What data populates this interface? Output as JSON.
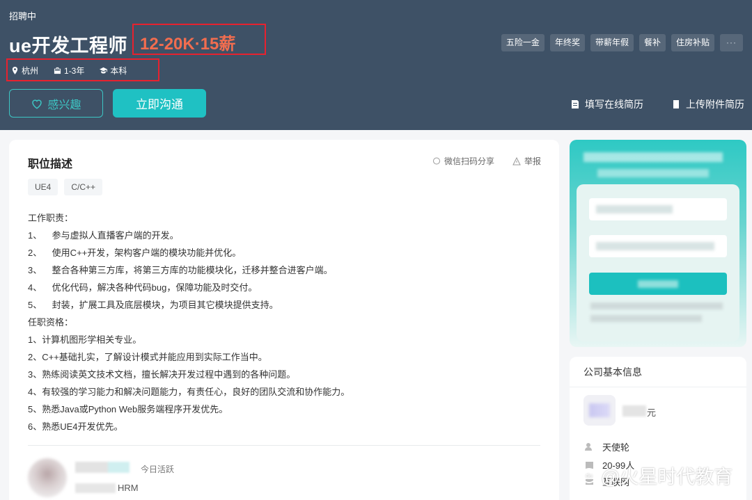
{
  "header": {
    "status": "招聘中",
    "job_title": "ue开发工程师",
    "salary": "12-20K·15薪",
    "meta": {
      "location": "杭州",
      "experience": "1-3年",
      "education": "本科"
    },
    "benefits": [
      "五险一金",
      "年终奖",
      "带薪年假",
      "餐补",
      "住房补贴"
    ],
    "more_label": "···",
    "interest_button": "感兴趣",
    "chat_button": "立即沟通",
    "fill_resume": "填写在线简历",
    "upload_resume": "上传附件简历"
  },
  "job": {
    "section_title": "职位描述",
    "share_label": "微信扫码分享",
    "report_label": "举报",
    "skills": [
      "UE4",
      "C/C++"
    ],
    "description": [
      "工作职责：",
      "1、    参与虚拟人直播客户端的开发。",
      "2、    使用C++开发，架构客户端的模块功能并优化。",
      "3、    整合各种第三方库，将第三方库的功能模块化，迁移并整合进客户端。",
      "4、    优化代码，解决各种代码bug，保障功能及时交付。",
      "5、    封装，扩展工具及底层模块，为项目其它模块提供支持。",
      "任职资格：",
      "1、计算机图形学相关专业。",
      "2、C++基础扎实，了解设计模式并能应用到实际工作当中。",
      "3、熟练阅读英文技术文档，擅长解决开发过程中遇到的各种问题。",
      "4、有较强的学习能力和解决问题能力，有责任心，良好的团队交流和协作能力。",
      "5、熟悉Java或Python Web服务端程序开发优先。",
      "6、熟悉UE4开发优先。"
    ]
  },
  "recruiter": {
    "active": "今日活跃",
    "role": "HRM"
  },
  "company": {
    "section_title": "公司基本信息",
    "name_suffix": "元",
    "funding": "天使轮",
    "size": "20-99人",
    "industry": "互联网"
  },
  "watermark": "@火星时代教育",
  "colors": {
    "header_bg": "#3e5166",
    "accent": "#1fc1c3",
    "salary": "#f26d4f",
    "highlight": "#e8212e"
  }
}
